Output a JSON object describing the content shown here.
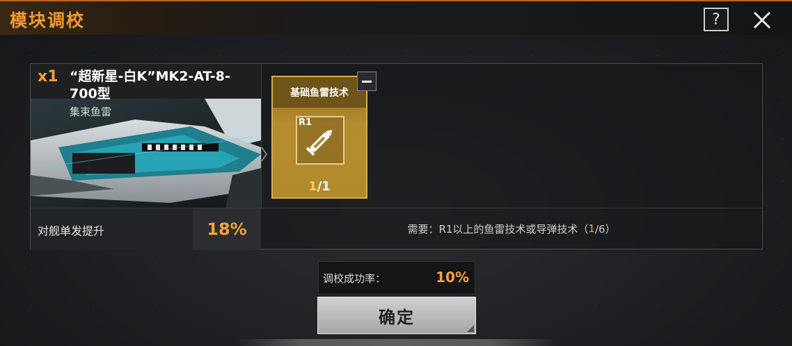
{
  "header": {
    "title": "模块调校",
    "help_label": "?"
  },
  "item": {
    "quantity": "x1",
    "name": "“超新星-白K”MK2-AT-8-700型",
    "type": "集束鱼雷",
    "stat_label": "对舰单发提升",
    "stat_value": "18%"
  },
  "material": {
    "name": "基础鱼雷技术",
    "rank": "R1",
    "count_current": "1",
    "count_sep": "/",
    "count_total": "1",
    "icon": "torpedo-icon"
  },
  "requirement": {
    "prefix": "需要：R1以上的鱼雷技术或导弹技术（",
    "selected": "1",
    "suffix": "/6）"
  },
  "success": {
    "label": "调校成功率：",
    "value": "10%"
  },
  "confirm": {
    "label": "确定"
  },
  "colors": {
    "accent": "#f2a23a",
    "material_bg": "#b08a2c"
  }
}
